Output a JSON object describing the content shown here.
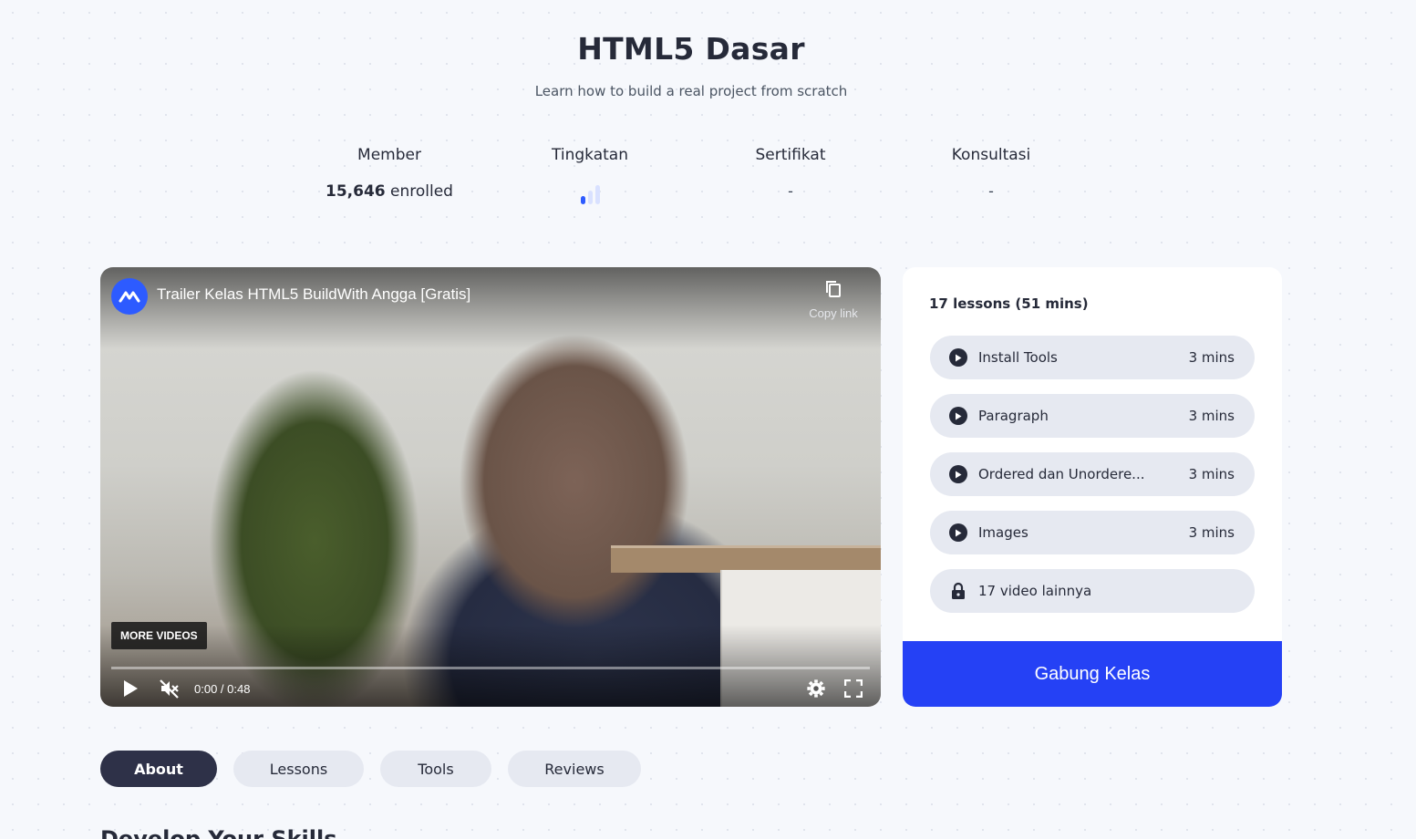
{
  "course": {
    "title": "HTML5 Dasar",
    "subtitle": "Learn how to build a real project from scratch"
  },
  "stats": {
    "member": {
      "label": "Member",
      "count": "15,646",
      "suffix": "enrolled"
    },
    "level": {
      "label": "Tingkatan",
      "icon": "level-bars-icon",
      "filled_bars": 1,
      "total_bars": 3
    },
    "certificate": {
      "label": "Sertifikat",
      "value": "-"
    },
    "consultation": {
      "label": "Konsultasi",
      "value": "-"
    }
  },
  "video": {
    "title": "Trailer Kelas HTML5 BuildWith Angga [Gratis]",
    "copy_link": "Copy link",
    "more_videos": "MORE VIDEOS",
    "time": "0:00 / 0:48",
    "progress": 0,
    "muted": true
  },
  "lessons": {
    "heading": "17 lessons (51 mins)",
    "items": [
      {
        "name": "Install Tools",
        "duration": "3 mins",
        "icon": "play-icon"
      },
      {
        "name": "Paragraph",
        "duration": "3 mins",
        "icon": "play-icon"
      },
      {
        "name": "Ordered dan Unordere...",
        "duration": "3 mins",
        "icon": "play-icon"
      },
      {
        "name": "Images",
        "duration": "3 mins",
        "icon": "play-icon"
      }
    ],
    "locked": {
      "name": "17 video lainnya",
      "icon": "lock-icon"
    },
    "join_button": "Gabung Kelas"
  },
  "tabs": [
    {
      "label": "About",
      "active": true
    },
    {
      "label": "Lessons",
      "active": false
    },
    {
      "label": "Tools",
      "active": false
    },
    {
      "label": "Reviews",
      "active": false
    }
  ],
  "section": {
    "heading": "Develop Your Skills"
  },
  "colors": {
    "accent": "#2541f5",
    "dark": "#2e3148",
    "pill": "#e6e9f1",
    "level_active": "#2d5bff",
    "level_inactive": "#d9e1ff"
  }
}
